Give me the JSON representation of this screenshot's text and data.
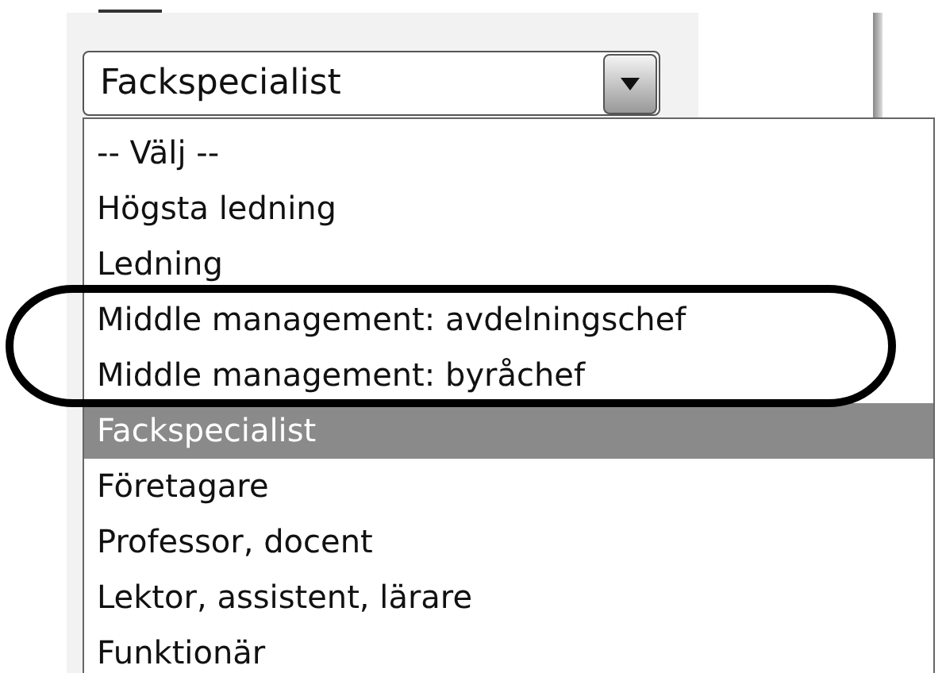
{
  "select": {
    "value": "Fackspecialist"
  },
  "options": [
    {
      "label": "-- Välj --",
      "selected": false
    },
    {
      "label": "Högsta ledning",
      "selected": false
    },
    {
      "label": "Ledning",
      "selected": false
    },
    {
      "label": "Middle management: avdelningschef",
      "selected": false
    },
    {
      "label": "Middle management: byråchef",
      "selected": false
    },
    {
      "label": "Fackspecialist",
      "selected": true
    },
    {
      "label": "Företagare",
      "selected": false
    },
    {
      "label": "Professor, docent",
      "selected": false
    },
    {
      "label": "Lektor, assistent, lärare",
      "selected": false
    },
    {
      "label": "Funktionär",
      "selected": false
    }
  ]
}
